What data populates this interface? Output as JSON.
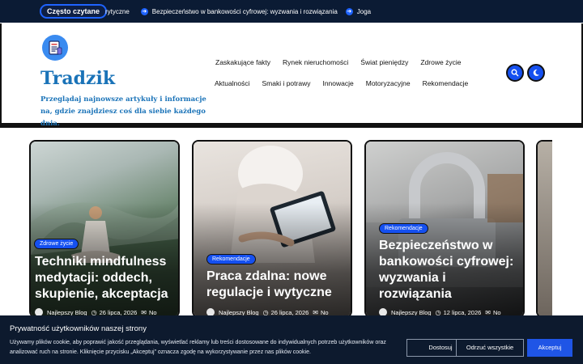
{
  "topbar": {
    "trending_label": "Często czytane",
    "ticker": [
      {
        "text": "rytyczne",
        "icon": "none"
      },
      {
        "text": "Bezpieczeństwo w bankowości cyfrowej: wyzwania i rozwiązania",
        "icon": "arrow-right-icon"
      },
      {
        "text": "Joga",
        "icon": "arrow-right-icon"
      }
    ]
  },
  "header": {
    "site_title": "Tradzik",
    "tagline": "Przeglądaj najnowsze artykuły i informacje na, gdzie znajdziesz coś dla siebie każdego dnia.",
    "nav_row1": [
      "Zaskakujące fakty",
      "Rynek nieruchomości",
      "Świat pieniędzy",
      "Zdrowe życie"
    ],
    "nav_row2": [
      "Aktualności",
      "Smaki i potrawy",
      "Innowacje",
      "Motoryzacyjne",
      "Rekomendacje"
    ],
    "search_icon": "search-icon",
    "theme_icon": "moon-icon"
  },
  "cards": [
    {
      "category": "Zdrowe życie",
      "title": "Techniki mindfulness medytacji: oddech, skupienie, akceptacja",
      "author": "Najlepszy Blog",
      "date": "26 lipca, 2026",
      "comments": "No"
    },
    {
      "category": "Rekomendacje",
      "title": "Praca zdalna: nowe regulacje i wytyczne",
      "author": "Najlepszy Blog",
      "date": "26 lipca, 2026",
      "comments": "No"
    },
    {
      "category": "Rekomendacje",
      "title": "Bezpieczeństwo w bankowości cyfrowej: wyzwania i rozwiązania",
      "author": "Najlepszy Blog",
      "date": "12 lipca, 2026",
      "comments": "No"
    }
  ],
  "cookie": {
    "title": "Prywatność użytkowników naszej strony",
    "text": "Używamy plików cookie, aby poprawić jakość przeglądania, wyświetlać reklamy lub treści dostosowane do indywidualnych potrzeb użytkowników oraz analizować ruch na stronie. Kliknięcie przycisku „Akceptuj” oznacza zgodę na wykorzystywanie przez nas plików cookie.",
    "btn_customize": "Dostosuj",
    "btn_reject": "Odrzuć wszystkie",
    "btn_accept": "Akceptuj"
  },
  "colors": {
    "accent": "#1550f0",
    "topbar": "#0b1b34",
    "title": "#1a73b8",
    "banner": "#0d1a2e"
  }
}
